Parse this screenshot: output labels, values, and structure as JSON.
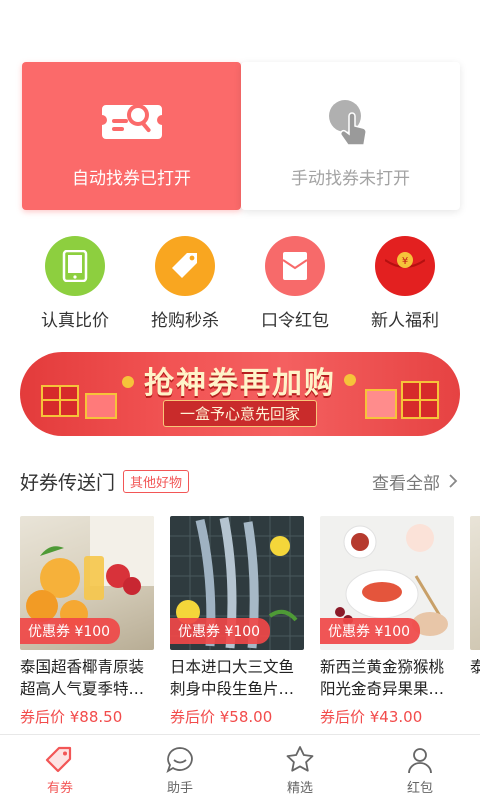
{
  "modes": {
    "auto": {
      "label": "自动找券已打开",
      "icon": "coupon-search-icon"
    },
    "manual": {
      "label": "手动找券未打开",
      "icon": "hand-tap-icon"
    }
  },
  "categories": [
    {
      "label": "认真比价",
      "icon": "phone-icon",
      "color": "#8dcf3f"
    },
    {
      "label": "抢购秒杀",
      "icon": "tag-icon",
      "color": "#f9a620"
    },
    {
      "label": "口令红包",
      "icon": "envelope-icon",
      "color": "#f76a6a"
    },
    {
      "label": "新人福利",
      "icon": "red-packet-icon",
      "color": "#e32020"
    }
  ],
  "banner": {
    "title": "抢神券再加购",
    "subtitle": "一盒予心意先回家"
  },
  "section": {
    "title": "好券传送门",
    "tag": "其他好物",
    "more": "查看全部"
  },
  "products": [
    {
      "badge": "优惠券 ¥100",
      "title": "泰国超香椰青原装超高人气夏季特…",
      "price": "券后价 ¥88.50"
    },
    {
      "badge": "优惠券 ¥100",
      "title": "日本进口大三文鱼刺身中段生鱼片…",
      "price": "券后价 ¥58.00"
    },
    {
      "badge": "优惠券 ¥100",
      "title": "新西兰黄金猕猴桃阳光金奇异果果…",
      "price": "券后价 ¥43.00"
    },
    {
      "badge": "",
      "title": "泰",
      "price": ""
    }
  ],
  "tabs": [
    {
      "label": "有券",
      "icon": "coupon-tag-icon",
      "active": true
    },
    {
      "label": "助手",
      "icon": "chat-bubble-icon",
      "active": false
    },
    {
      "label": "精选",
      "icon": "star-icon",
      "active": false
    },
    {
      "label": "红包",
      "icon": "person-icon",
      "active": false
    }
  ],
  "colors": {
    "accent": "#f25656",
    "auto_card": "#fb6a6a"
  }
}
